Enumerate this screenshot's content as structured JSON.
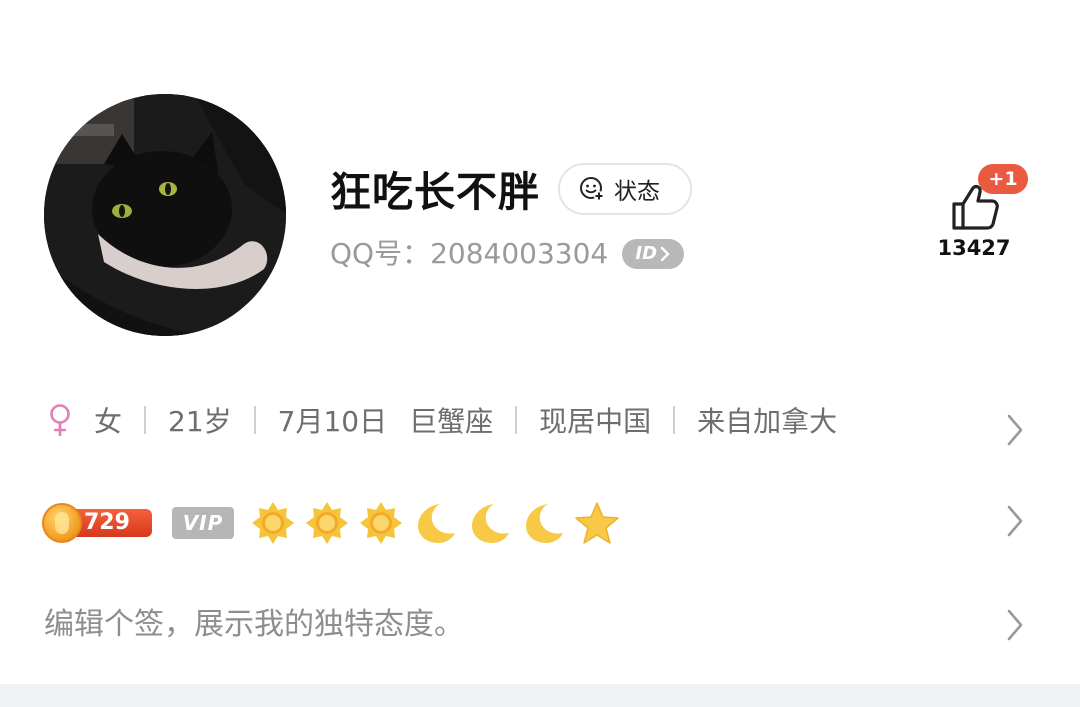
{
  "profile": {
    "nickname": "狂吃长不胖",
    "status_chip": {
      "label": "状态",
      "icon": "smiley-add-icon"
    },
    "qq_label": "QQ号：2084003304",
    "id_badge": "ID"
  },
  "like": {
    "plus_badge": "+1",
    "count": "13427",
    "icon": "thumbs-up-icon"
  },
  "info": {
    "gender_icon": "female-icon",
    "gender": "女",
    "age": "21岁",
    "birthday": "7月10日",
    "zodiac": "巨蟹座",
    "location": "现居中国",
    "hometown": "来自加拿大"
  },
  "badges": {
    "level": "729",
    "vip": "VIP",
    "level_icons": [
      "sun-icon",
      "sun-icon",
      "sun-icon",
      "moon-icon",
      "moon-icon",
      "moon-icon",
      "star-icon"
    ]
  },
  "signature": {
    "placeholder": "编辑个签，展示我的独特态度。"
  },
  "colors": {
    "accent_red": "#ea5a40",
    "level_orange": "#f4623b",
    "gold": "#f5c233",
    "gender_pink": "#e27fb4",
    "muted_text": "#8e8e8e",
    "badge_grey": "#b6b6b6"
  }
}
